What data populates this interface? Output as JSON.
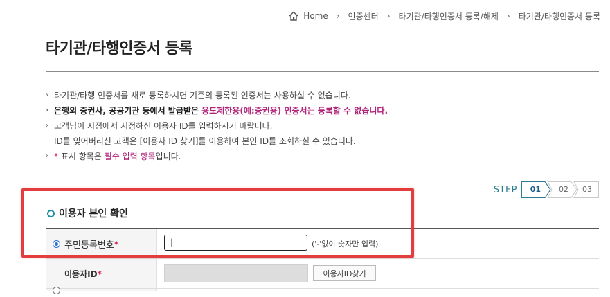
{
  "breadcrumb": {
    "home": "Home",
    "items": [
      "인증센터",
      "타기관/타행인증서 등록/해제",
      "타기관/타행인증서 등록"
    ]
  },
  "page": {
    "title": "타기관/타행인증서 등록"
  },
  "notices": {
    "n1": "타기관/타행 인증서를 새로 등록하시면 기존의 등록된 인증서는 사용하실 수 없습니다.",
    "n2_a": "은행외 증권사, 공공기관 등에서 발급받은 ",
    "n2_b": "용도제한용(예:증권용) 인증서는 등록할 수 없습니다.",
    "n3_a": "고객님이 지점에서 지정하신 이용자 ID를 입력하시기 바랍니다.",
    "n3_b": "ID를 잊어버리신 고객은 [이용자 ID 찾기]를 이용하여 본인 ID를 조회하실 수 있습니다.",
    "n4_star": "*",
    "n4_a": " 표시 항목은 ",
    "n4_b": "필수 입력 항목",
    "n4_c": "입니다."
  },
  "step": {
    "label": "STEP",
    "steps": [
      "01",
      "02",
      "03"
    ]
  },
  "section": {
    "title": "이용자 본인 확인"
  },
  "form": {
    "rrn_label": "주민등록번호",
    "rrn_required": "*",
    "rrn_value": "|",
    "rrn_hint": "('-'없이 숫자만 입력)",
    "userid_label": "이용자ID",
    "userid_required": "*",
    "find_button": "이용자ID찾기"
  },
  "colors": {
    "accent": "#2a7d8e",
    "highlight": "#e43d3d",
    "pink": "#b0247a",
    "required": "#d6204a"
  }
}
